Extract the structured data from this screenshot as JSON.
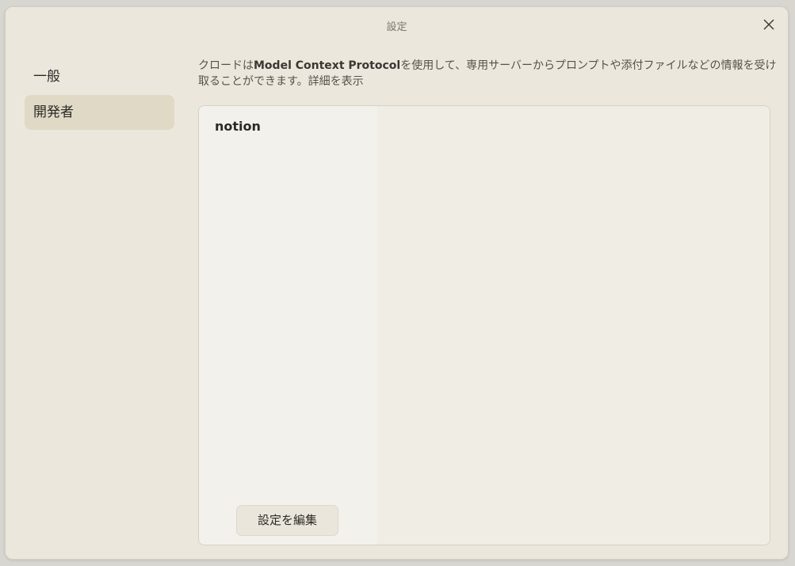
{
  "window": {
    "title": "設定",
    "close_icon": "close-icon"
  },
  "sidebar": {
    "items": [
      {
        "label": "一般",
        "active": false
      },
      {
        "label": "開発者",
        "active": true
      }
    ]
  },
  "main": {
    "description_pre": "クロードは",
    "description_bold": "Model Context Protocol",
    "description_post": "を使用して、専用サーバーからプロンプトや添付ファイルなどの情報を受け取ることができます。",
    "description_link": "詳細を表示",
    "servers": [
      {
        "name": "notion"
      }
    ],
    "edit_config_label": "設定を編集"
  },
  "colors": {
    "window_bg": "#ece7dc",
    "sidebar_active_bg": "#dfd9c6",
    "server_list_bg": "#f3f1ec",
    "detail_bg": "#efede4"
  }
}
